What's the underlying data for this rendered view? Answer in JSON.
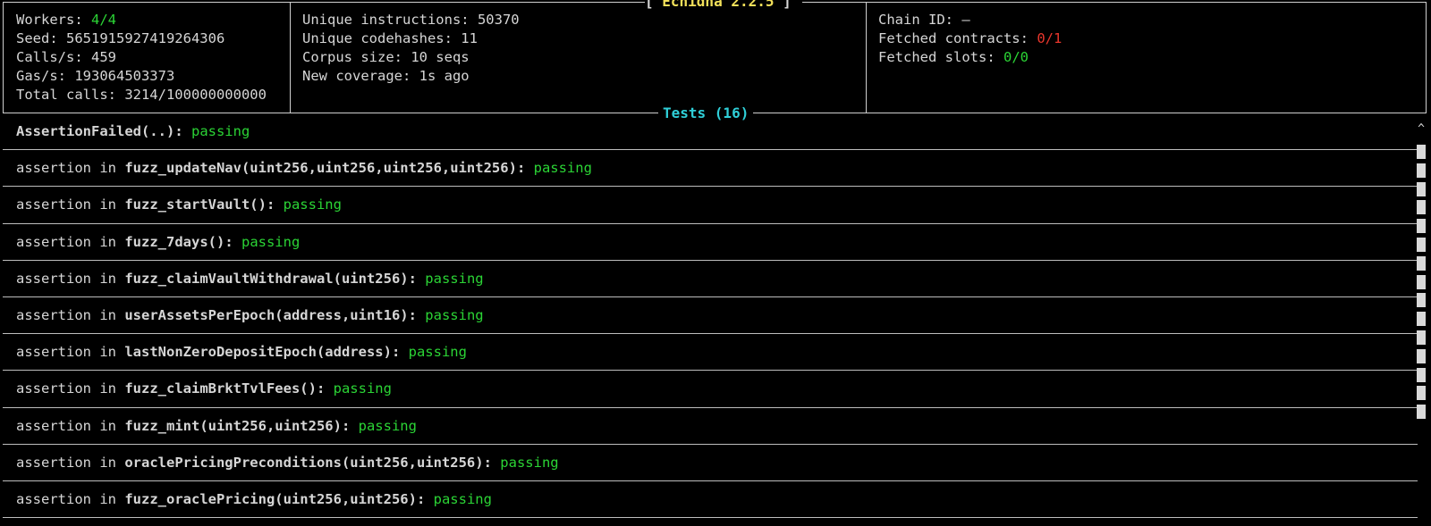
{
  "app": {
    "title": "Echidna 2.2.5"
  },
  "status": {
    "workers_label": "Workers: ",
    "workers_value": "4/4",
    "seed": "Seed: 5651915927419264306",
    "calls_per_sec": "Calls/s: 459",
    "gas_per_sec": "Gas/s: 193064503373",
    "total_calls": "Total calls: 3214/100000000000",
    "unique_instructions": "Unique instructions: 50370",
    "unique_codehashes": "Unique codehashes: 11",
    "corpus_size": "Corpus size: 10 seqs",
    "new_coverage": "New coverage: 1s ago",
    "chain_id": "Chain ID: —",
    "fetched_contracts_label": "Fetched contracts: ",
    "fetched_contracts_value": "0/1",
    "fetched_slots_label": "Fetched slots: ",
    "fetched_slots_value": "0/0"
  },
  "colors": {
    "passing": "#2bd435",
    "error": "#e8362c",
    "title": "#f2e05a",
    "tests_title": "#2fcfd8"
  },
  "tests": {
    "title": "Tests (16)",
    "scroll_up_icon": "caret-up-icon",
    "items": [
      {
        "prefix": "",
        "name": "AssertionFailed(..)",
        "sep": ": ",
        "status": "passing"
      },
      {
        "prefix": "assertion in ",
        "name": "fuzz_updateNav(uint256,uint256,uint256,uint256)",
        "sep": ": ",
        "status": "passing"
      },
      {
        "prefix": "assertion in ",
        "name": "fuzz_startVault()",
        "sep": ": ",
        "status": "passing"
      },
      {
        "prefix": "assertion in ",
        "name": "fuzz_7days()",
        "sep": ": ",
        "status": "passing"
      },
      {
        "prefix": "assertion in ",
        "name": "fuzz_claimVaultWithdrawal(uint256)",
        "sep": ": ",
        "status": "passing"
      },
      {
        "prefix": "assertion in ",
        "name": "userAssetsPerEpoch(address,uint16)",
        "sep": ": ",
        "status": "passing"
      },
      {
        "prefix": "assertion in ",
        "name": "lastNonZeroDepositEpoch(address)",
        "sep": ": ",
        "status": "passing"
      },
      {
        "prefix": "assertion in ",
        "name": "fuzz_claimBrktTvlFees()",
        "sep": ": ",
        "status": "passing"
      },
      {
        "prefix": "assertion in ",
        "name": "fuzz_mint(uint256,uint256)",
        "sep": ": ",
        "status": "passing"
      },
      {
        "prefix": "assertion in ",
        "name": "oraclePricingPreconditions(uint256,uint256)",
        "sep": ": ",
        "status": "passing"
      },
      {
        "prefix": "assertion in ",
        "name": "fuzz_oraclePricing(uint256,uint256)",
        "sep": ": ",
        "status": "passing"
      }
    ]
  }
}
